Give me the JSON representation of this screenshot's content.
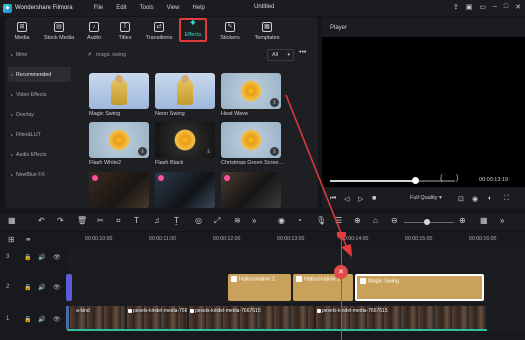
{
  "app": {
    "name": "Wondershare Filmora",
    "window_title": "Untitled",
    "menu": [
      "File",
      "Edit",
      "Tools",
      "View",
      "Help"
    ]
  },
  "media_tabs": [
    {
      "label": "Media",
      "icon": "media-icon"
    },
    {
      "label": "Stock Media",
      "icon": "stock-media-icon"
    },
    {
      "label": "Audio",
      "icon": "audio-icon"
    },
    {
      "label": "Titles",
      "icon": "titles-icon"
    },
    {
      "label": "Transitions",
      "icon": "transitions-icon"
    },
    {
      "label": "Effects",
      "icon": "effects-icon",
      "active": true
    },
    {
      "label": "Stickers",
      "icon": "stickers-icon"
    },
    {
      "label": "Templates",
      "icon": "templates-icon"
    }
  ],
  "sidebar": {
    "items": [
      {
        "label": "Mine"
      },
      {
        "label": "Recommended",
        "active": true
      },
      {
        "label": "Video Effects"
      },
      {
        "label": "Overlay"
      },
      {
        "label": "Filter&LUT"
      },
      {
        "label": "Audio Effects"
      },
      {
        "label": "NewBlue FX"
      }
    ]
  },
  "search": {
    "value": "magic swing"
  },
  "filter": {
    "selected": "All"
  },
  "effects": [
    {
      "name": "Magic Swing"
    },
    {
      "name": "Neon Swing"
    },
    {
      "name": "Heat Wave"
    },
    {
      "name": "Flash White2"
    },
    {
      "name": "Flash Black"
    },
    {
      "name": "Christmas Green Scree..."
    }
  ],
  "player": {
    "title": "Player",
    "time": "00:00:13:19",
    "quality": "Full Quality",
    "progress": 0.68
  },
  "timeline": {
    "ruler": [
      "00:00:10:00",
      "00:00:11:00",
      "00:00:12:00",
      "00:00:13:00",
      "00:00:14:00",
      "00:00:15:00",
      "00:00:16:00"
    ],
    "effect_clips": [
      "Hallucination 2",
      "Hallucination 1",
      "Magic Swing"
    ],
    "video_clips": [
      "pexels-kindel-media-7667615",
      "pexels-kindel-media-7667615",
      "pexels-kindel-media-7667615"
    ],
    "tracks": [
      "3",
      "2",
      "1"
    ]
  },
  "colors": {
    "accent": "#2de0c8",
    "highlight": "#e23b3b",
    "effect_clip": "#c9a15a"
  }
}
